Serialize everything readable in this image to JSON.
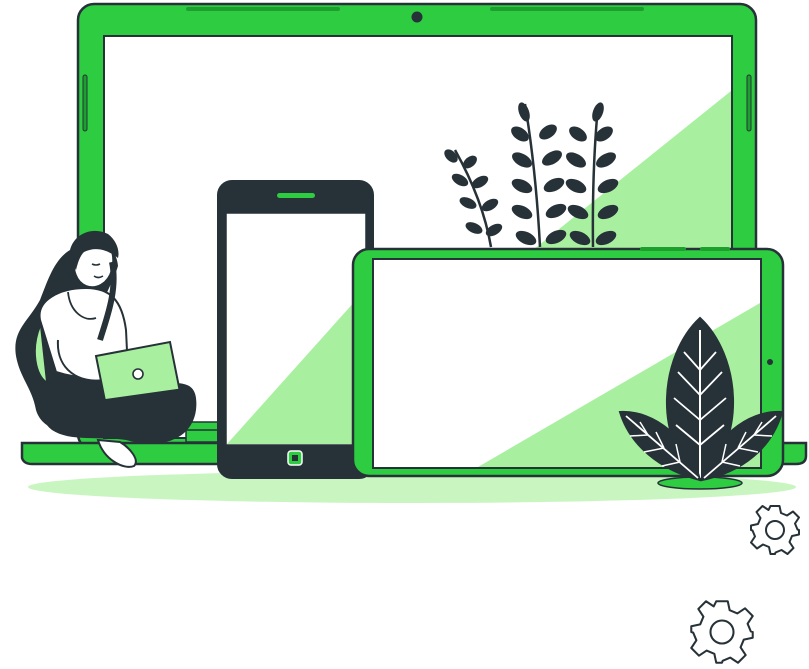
{
  "illustration": {
    "subject": "responsive-devices",
    "colors": {
      "accent": "#2ecc40",
      "accent_light": "#a8f0a0",
      "floor": "#c9f5c1",
      "ink": "#263238",
      "screen": "#ffffff",
      "skin": "#ffffff"
    },
    "devices": [
      "laptop",
      "smartphone",
      "tablet"
    ],
    "decorations": [
      "woman-with-laptop",
      "fern-sprigs",
      "leaf-plant",
      "floor-shadow"
    ]
  },
  "controls": {
    "gear_icons": [
      "settings-gear",
      "settings-gear"
    ]
  }
}
